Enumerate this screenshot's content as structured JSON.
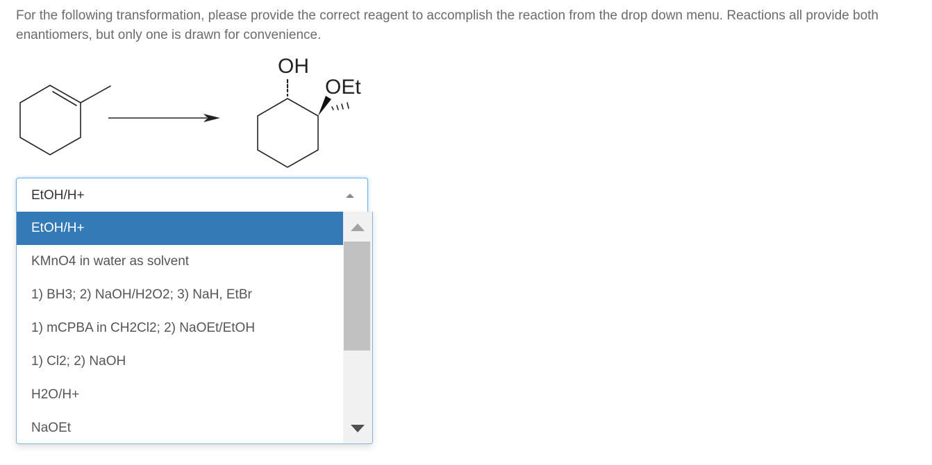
{
  "question": {
    "text": "For the following transformation, please provide the correct reagent to accomplish the reaction from the drop down menu. Reactions all provide both enantiomers, but only one is drawn for convenience."
  },
  "scheme": {
    "product_oh_label": "OH",
    "product_oet_label": "OEt"
  },
  "select": {
    "value": "EtOH/H+",
    "expanded": true
  },
  "options": [
    {
      "label": "EtOH/H+",
      "selected": true
    },
    {
      "label": "KMnO4 in water as solvent",
      "selected": false
    },
    {
      "label": "1) BH3; 2) NaOH/H2O2; 3) NaH, EtBr",
      "selected": false
    },
    {
      "label": "1) mCPBA in CH2Cl2; 2) NaOEt/EtOH",
      "selected": false
    },
    {
      "label": "1) Cl2; 2) NaOH",
      "selected": false
    },
    {
      "label": "H2O/H+",
      "selected": false
    },
    {
      "label": "NaOEt",
      "selected": false
    }
  ],
  "colors": {
    "selected_bg": "#337ab7",
    "focus_border": "#66afe9"
  }
}
